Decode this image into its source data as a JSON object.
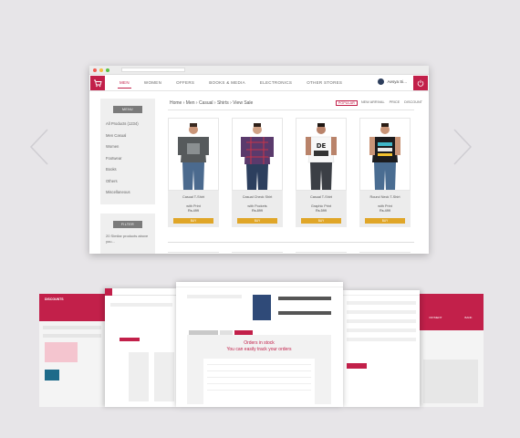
{
  "colors": {
    "accent": "#c2204a",
    "button": "#e0a628",
    "sidebar_head": "#7b7b7b"
  },
  "browser": {
    "nav_items": [
      "MEN",
      "WOMEN",
      "OFFERS",
      "BOOKS & MEDIA",
      "ELECTRONICS",
      "OTHER STORES"
    ],
    "user_name": "Aesya Si...",
    "breadcrumb": "Home › Men › Casual › Shirts › View Sale",
    "sort_options": [
      "POPULAR",
      "NEW ARRIVAL",
      "PRICE",
      "DISCOUNT"
    ],
    "sidebar": {
      "heading": "MENU",
      "items": [
        "All Products (1234)",
        "Men Casual",
        "Women",
        "Footwear",
        "Books",
        "Others",
        "Miscellaneous"
      ],
      "heading2": "FILTER",
      "note": "20 Similar products above you..."
    },
    "products": [
      {
        "title": "Casual T-Shirt",
        "sub": "with Print",
        "price": "Rs.499",
        "button": "BUY"
      },
      {
        "title": "Casual Check Shirt",
        "sub": "with Pockets",
        "price": "Rs.899",
        "button": "BUY"
      },
      {
        "title": "Casual T-Shirt",
        "sub": "Graphic Print",
        "price": "Rs.599",
        "button": "BUY"
      },
      {
        "title": "Round Neck T-Shirt",
        "sub": "with Print",
        "price": "Rs.499",
        "button": "BUY"
      }
    ]
  },
  "screens": {
    "s1": {
      "heading": "DISCOUNTS"
    },
    "s3": {
      "title": "Orders in stock",
      "subtitle": "You can easily track your orders"
    },
    "s5": {
      "label1": "PAYMENT",
      "label2": "BANK"
    }
  },
  "icons": [
    "chevron-left-icon",
    "chevron-right-icon",
    "cart-icon",
    "power-icon"
  ]
}
